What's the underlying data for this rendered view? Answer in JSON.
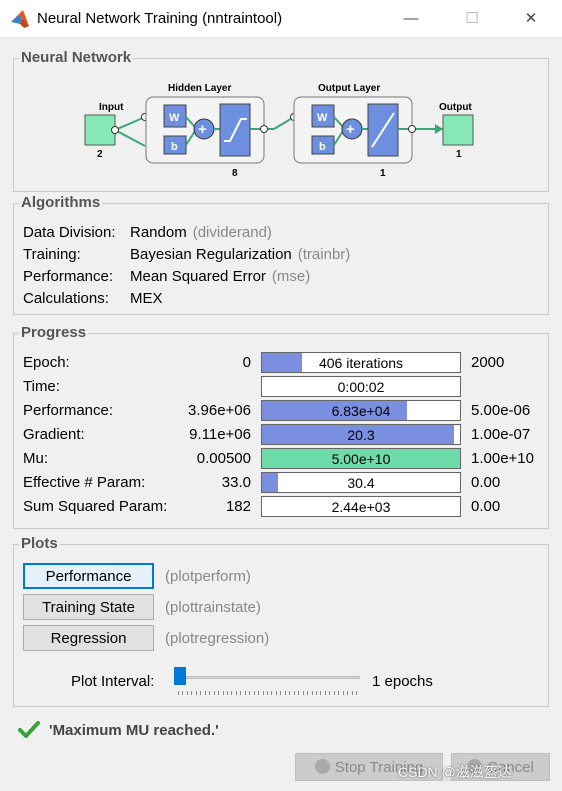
{
  "window": {
    "title": "Neural Network Training (nntraintool)",
    "minimize_glyph": "—",
    "maximize_glyph": "☐",
    "close_glyph": "✕"
  },
  "network": {
    "section_title": "Neural Network",
    "input_label": "Input",
    "input_size": "2",
    "hidden_label": "Hidden Layer",
    "hidden_size": "8",
    "output_layer_label": "Output Layer",
    "output_layer_size": "1",
    "output_label": "Output",
    "output_size": "1",
    "weight_label": "W",
    "bias_label": "b",
    "sum_symbol": "+"
  },
  "algorithms": {
    "section_title": "Algorithms",
    "rows": [
      {
        "label": "Data Division:",
        "value": "Random",
        "code": "(dividerand)"
      },
      {
        "label": "Training:",
        "value": "Bayesian Regularization",
        "code": "(trainbr)"
      },
      {
        "label": "Performance:",
        "value": "Mean Squared Error",
        "code": "(mse)"
      },
      {
        "label": "Calculations:",
        "value": "MEX",
        "code": ""
      }
    ]
  },
  "progress": {
    "section_title": "Progress",
    "rows": [
      {
        "label": "Epoch:",
        "start": "0",
        "bar_text": "406 iterations",
        "end": "2000",
        "fill": 0.2,
        "color": "#7b8fe0"
      },
      {
        "label": "Time:",
        "start": "",
        "bar_text": "0:00:02",
        "end": "",
        "fill": 0,
        "color": "#7b8fe0"
      },
      {
        "label": "Performance:",
        "start": "3.96e+06",
        "bar_text": "6.83e+04",
        "end": "5.00e-06",
        "fill": 0.73,
        "color": "#7b8fe0"
      },
      {
        "label": "Gradient:",
        "start": "9.11e+06",
        "bar_text": "20.3",
        "end": "1.00e-07",
        "fill": 0.97,
        "color": "#7b8fe0"
      },
      {
        "label": "Mu:",
        "start": "0.00500",
        "bar_text": "5.00e+10",
        "end": "1.00e+10",
        "fill": 1.0,
        "color": "#6ddca8"
      },
      {
        "label": "Effective # Param:",
        "start": "33.0",
        "bar_text": "30.4",
        "end": "0.00",
        "fill": 0.08,
        "color": "#7b8fe0"
      },
      {
        "label": "Sum Squared Param:",
        "start": "182",
        "bar_text": "2.44e+03",
        "end": "0.00",
        "fill": 0,
        "color": "#7b8fe0"
      }
    ]
  },
  "plots": {
    "section_title": "Plots",
    "buttons": [
      {
        "label": "Performance",
        "fn": "(plotperform)"
      },
      {
        "label": "Training State",
        "fn": "(plottrainstate)"
      },
      {
        "label": "Regression",
        "fn": "(plotregression)"
      }
    ],
    "interval_label": "Plot Interval:",
    "interval_value": "1 epochs",
    "interval_level": 0
  },
  "status": {
    "message": "'Maximum MU reached.'"
  },
  "footer": {
    "stop_label": "Stop Training",
    "cancel_label": "Cancel",
    "watermark": "CSDN @滋滋盔达"
  },
  "colors": {
    "node_green": "#86e8b4",
    "layer_blue": "#6d8fe0",
    "checkmark_green": "#3aa03a"
  }
}
